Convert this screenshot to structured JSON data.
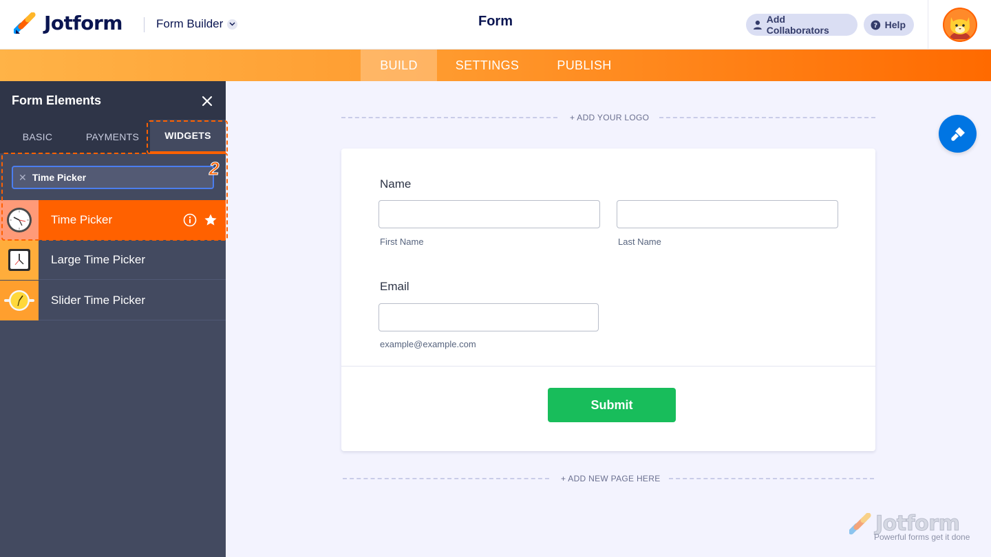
{
  "header": {
    "logo_text": "Jotform",
    "builder_label": "Form Builder",
    "form_title": "Form",
    "add_collaborators_label": "Add Collaborators",
    "help_label": "Help"
  },
  "nav": {
    "tabs": [
      {
        "label": "BUILD",
        "active": true
      },
      {
        "label": "SETTINGS",
        "active": false
      },
      {
        "label": "PUBLISH",
        "active": false
      }
    ]
  },
  "sidebar": {
    "title": "Form Elements",
    "tabs": [
      {
        "label": "BASIC",
        "active": false
      },
      {
        "label": "PAYMENTS",
        "active": false
      },
      {
        "label": "WIDGETS",
        "active": true
      }
    ],
    "search_value": "Time Picker",
    "step_number": "2",
    "widgets": [
      {
        "label": "Time Picker",
        "icon": "clock-icon",
        "selected": true
      },
      {
        "label": "Large Time Picker",
        "icon": "square-clock-icon",
        "selected": false
      },
      {
        "label": "Slider Time Picker",
        "icon": "yellow-clock-icon",
        "selected": false
      }
    ]
  },
  "canvas": {
    "add_logo": "+ ADD YOUR LOGO",
    "add_page": "+ ADD NEW PAGE HERE",
    "form": {
      "name_label": "Name",
      "first_name_sub": "First Name",
      "last_name_sub": "Last Name",
      "email_label": "Email",
      "email_sub": "example@example.com",
      "submit_label": "Submit"
    }
  },
  "watermark": {
    "text": "Jotform",
    "tagline": "Powerful forms get it done"
  },
  "colors": {
    "brand_orange": "#ff6100",
    "submit_green": "#18bd5b",
    "navy": "#0a1551",
    "sidebar_bg": "#434a60",
    "accent_blue": "#0075e3"
  }
}
